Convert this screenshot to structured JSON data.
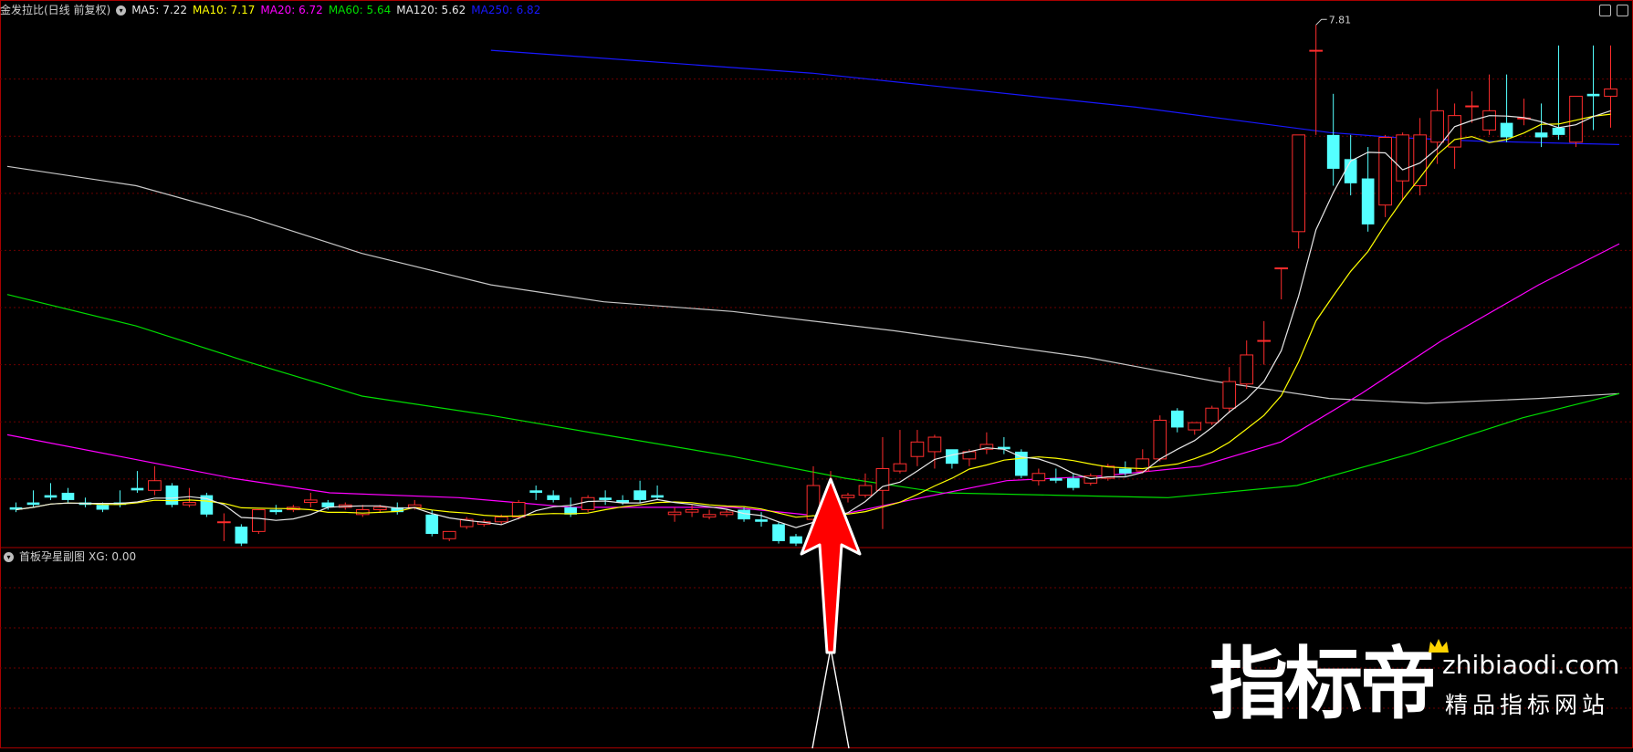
{
  "colors": {
    "bg": "#000000",
    "up": "#ff2d2d",
    "down": "#54ffff",
    "grid": "#6b0000",
    "panel_border": "#a80000",
    "ma5": "#e8e8e8",
    "ma10": "#ffff00",
    "ma20": "#ff00ff",
    "ma60": "#00dd00",
    "ma120": "#c7c7c7",
    "ma250": "#1818ff",
    "label": "#d0d0d0",
    "arrow": "#ff0000"
  },
  "top_panel": {
    "title": "金发拉比(日线 前复权)",
    "indicators": [
      {
        "label": "MA5: 7.22",
        "color": "#e8e8e8"
      },
      {
        "label": "MA10: 7.17",
        "color": "#ffff00"
      },
      {
        "label": "MA20: 6.72",
        "color": "#ff00ff"
      },
      {
        "label": "MA60: 5.64",
        "color": "#00dd00"
      },
      {
        "label": "MA120: 5.62",
        "color": "#e8e8e8"
      },
      {
        "label": "MA250: 6.82",
        "color": "#1818ff"
      }
    ],
    "high_marker": "7.81"
  },
  "bottom_panel": {
    "title": "首板孕星副图",
    "readout": "XG: 0.00"
  },
  "watermark": {
    "brand": "指标帝",
    "url": "zhibiaodi.com",
    "slogan": "精品指标网站"
  },
  "chart_data": {
    "type": "candlestick",
    "price_range": [
      3.6,
      7.85
    ],
    "candles": [
      [
        3.82,
        3.86,
        3.8,
        3.78
      ],
      [
        3.86,
        3.96,
        3.84,
        3.82
      ],
      [
        3.92,
        4.02,
        3.9,
        3.88
      ],
      [
        3.94,
        3.98,
        3.88,
        3.86
      ],
      [
        3.86,
        3.9,
        3.84,
        3.82
      ],
      [
        3.84,
        3.86,
        3.8,
        3.78
      ],
      [
        3.86,
        3.96,
        3.84,
        3.82
      ],
      [
        3.98,
        4.12,
        3.96,
        3.94
      ],
      [
        3.96,
        4.16,
        4.04,
        3.92
      ],
      [
        4.0,
        4.02,
        3.84,
        3.82
      ],
      [
        3.84,
        3.98,
        3.86,
        3.82
      ],
      [
        3.92,
        3.94,
        3.76,
        3.74
      ],
      [
        3.7,
        3.77,
        3.7,
        3.54
      ],
      [
        3.66,
        3.68,
        3.52,
        3.5
      ],
      [
        3.62,
        3.8,
        3.8,
        3.6
      ],
      [
        3.8,
        3.84,
        3.78,
        3.76
      ],
      [
        3.8,
        3.84,
        3.82,
        3.78
      ],
      [
        3.86,
        3.94,
        3.88,
        3.82
      ],
      [
        3.86,
        3.88,
        3.82,
        3.8
      ],
      [
        3.82,
        3.86,
        3.84,
        3.8
      ],
      [
        3.76,
        3.84,
        3.8,
        3.74
      ],
      [
        3.8,
        3.84,
        3.82,
        3.78
      ],
      [
        3.82,
        3.86,
        3.78,
        3.76
      ],
      [
        3.82,
        3.88,
        3.84,
        3.8
      ],
      [
        3.76,
        3.8,
        3.6,
        3.58
      ],
      [
        3.56,
        3.62,
        3.62,
        3.54
      ],
      [
        3.66,
        3.74,
        3.72,
        3.64
      ],
      [
        3.68,
        3.72,
        3.7,
        3.66
      ],
      [
        3.7,
        3.76,
        3.74,
        3.68
      ],
      [
        3.74,
        3.88,
        3.86,
        3.72
      ],
      [
        3.96,
        4.0,
        3.94,
        3.88
      ],
      [
        3.92,
        3.96,
        3.88,
        3.86
      ],
      [
        3.82,
        3.9,
        3.76,
        3.74
      ],
      [
        3.8,
        3.92,
        3.9,
        3.78
      ],
      [
        3.9,
        3.96,
        3.88,
        3.84
      ],
      [
        3.88,
        3.92,
        3.86,
        3.84
      ],
      [
        3.96,
        4.04,
        3.88,
        3.86
      ],
      [
        3.92,
        4.0,
        3.9,
        3.88
      ],
      [
        3.76,
        3.82,
        3.78,
        3.7
      ],
      [
        3.78,
        3.84,
        3.8,
        3.74
      ],
      [
        3.74,
        3.8,
        3.76,
        3.72
      ],
      [
        3.76,
        3.8,
        3.78,
        3.74
      ],
      [
        3.8,
        3.82,
        3.72,
        3.7
      ],
      [
        3.72,
        3.78,
        3.7,
        3.66
      ],
      [
        3.68,
        3.7,
        3.54,
        3.52
      ],
      [
        3.58,
        3.6,
        3.52,
        3.5
      ],
      [
        3.72,
        4.16,
        4.0,
        3.6
      ],
      [
        3.9,
        4.12,
        3.9,
        3.86
      ],
      [
        3.9,
        3.94,
        3.92,
        3.86
      ],
      [
        3.92,
        4.1,
        4.0,
        3.9
      ],
      [
        3.96,
        4.4,
        4.14,
        3.64
      ],
      [
        4.12,
        4.46,
        4.18,
        4.1
      ],
      [
        4.24,
        4.46,
        4.36,
        4.16
      ],
      [
        4.28,
        4.42,
        4.4,
        4.14
      ],
      [
        4.3,
        4.24,
        4.18,
        4.14
      ],
      [
        4.22,
        4.3,
        4.28,
        4.16
      ],
      [
        4.3,
        4.44,
        4.34,
        4.26
      ],
      [
        4.32,
        4.4,
        4.3,
        4.26
      ],
      [
        4.28,
        4.3,
        4.08,
        4.06
      ],
      [
        4.04,
        4.14,
        4.1,
        4.0
      ],
      [
        4.06,
        4.14,
        4.04,
        4.02
      ],
      [
        4.06,
        4.1,
        3.98,
        3.96
      ],
      [
        4.02,
        4.1,
        4.08,
        4.0
      ],
      [
        4.06,
        4.18,
        4.16,
        4.04
      ],
      [
        4.14,
        4.2,
        4.1,
        4.08
      ],
      [
        4.12,
        4.3,
        4.22,
        4.1
      ],
      [
        4.22,
        4.58,
        4.54,
        4.2
      ],
      [
        4.62,
        4.64,
        4.48,
        4.44
      ],
      [
        4.46,
        4.52,
        4.52,
        4.42
      ],
      [
        4.52,
        4.66,
        4.64,
        4.5
      ],
      [
        4.64,
        4.98,
        4.86,
        4.6
      ],
      [
        4.84,
        5.2,
        5.08,
        4.8
      ],
      [
        5.2,
        5.36,
        5.2,
        5.0
      ],
      [
        5.8,
        5.8,
        5.8,
        5.54
      ],
      [
        6.1,
        6.9,
        6.9,
        5.96
      ],
      [
        7.6,
        7.81,
        7.6,
        6.9
      ],
      [
        6.9,
        7.24,
        6.62,
        6.48
      ],
      [
        6.7,
        6.9,
        6.5,
        6.4
      ],
      [
        6.54,
        6.8,
        6.16,
        6.1
      ],
      [
        6.32,
        6.9,
        6.88,
        6.22
      ],
      [
        6.52,
        6.92,
        6.9,
        6.36
      ],
      [
        6.48,
        7.04,
        6.9,
        6.4
      ],
      [
        6.84,
        7.28,
        7.1,
        6.66
      ],
      [
        6.8,
        7.16,
        7.06,
        6.62
      ],
      [
        7.14,
        7.26,
        7.14,
        7.0
      ],
      [
        6.94,
        7.4,
        7.1,
        6.9
      ],
      [
        7.0,
        7.4,
        6.88,
        6.84
      ],
      [
        7.04,
        7.2,
        7.04,
        6.98
      ],
      [
        6.92,
        7.16,
        6.88,
        6.8
      ],
      [
        6.96,
        7.64,
        6.9,
        6.86
      ],
      [
        6.84,
        7.18,
        7.22,
        6.8
      ],
      [
        7.24,
        7.64,
        7.22,
        6.94
      ],
      [
        7.22,
        7.64,
        7.28,
        6.96
      ]
    ],
    "ma250": [
      [
        0.3,
        7.6
      ],
      [
        0.5,
        7.41
      ],
      [
        0.7,
        7.13
      ],
      [
        0.82,
        6.92
      ],
      [
        0.86,
        6.88
      ],
      [
        0.91,
        6.85
      ],
      [
        0.97,
        6.83
      ],
      [
        1.0,
        6.82
      ]
    ],
    "ma120": [
      [
        0.0,
        6.64
      ],
      [
        0.08,
        6.48
      ],
      [
        0.15,
        6.22
      ],
      [
        0.22,
        5.92
      ],
      [
        0.3,
        5.66
      ],
      [
        0.37,
        5.52
      ],
      [
        0.45,
        5.44
      ],
      [
        0.55,
        5.28
      ],
      [
        0.67,
        5.06
      ],
      [
        0.75,
        4.86
      ],
      [
        0.82,
        4.72
      ],
      [
        0.88,
        4.68
      ],
      [
        0.95,
        4.72
      ],
      [
        1.0,
        4.76
      ]
    ],
    "ma60": [
      [
        0.0,
        5.58
      ],
      [
        0.08,
        5.32
      ],
      [
        0.15,
        5.02
      ],
      [
        0.22,
        4.74
      ],
      [
        0.3,
        4.58
      ],
      [
        0.37,
        4.42
      ],
      [
        0.45,
        4.24
      ],
      [
        0.52,
        4.06
      ],
      [
        0.58,
        3.94
      ],
      [
        0.65,
        3.92
      ],
      [
        0.72,
        3.9
      ],
      [
        0.8,
        4.0
      ],
      [
        0.87,
        4.26
      ],
      [
        0.94,
        4.56
      ],
      [
        1.0,
        4.76
      ]
    ],
    "ma20": [
      [
        0.0,
        4.42
      ],
      [
        0.07,
        4.24
      ],
      [
        0.14,
        4.06
      ],
      [
        0.2,
        3.94
      ],
      [
        0.28,
        3.9
      ],
      [
        0.35,
        3.82
      ],
      [
        0.45,
        3.82
      ],
      [
        0.51,
        3.74
      ],
      [
        0.56,
        3.88
      ],
      [
        0.62,
        4.04
      ],
      [
        0.68,
        4.08
      ],
      [
        0.74,
        4.16
      ],
      [
        0.79,
        4.36
      ],
      [
        0.84,
        4.76
      ],
      [
        0.89,
        5.2
      ],
      [
        0.95,
        5.66
      ],
      [
        1.0,
        6.0
      ]
    ]
  }
}
